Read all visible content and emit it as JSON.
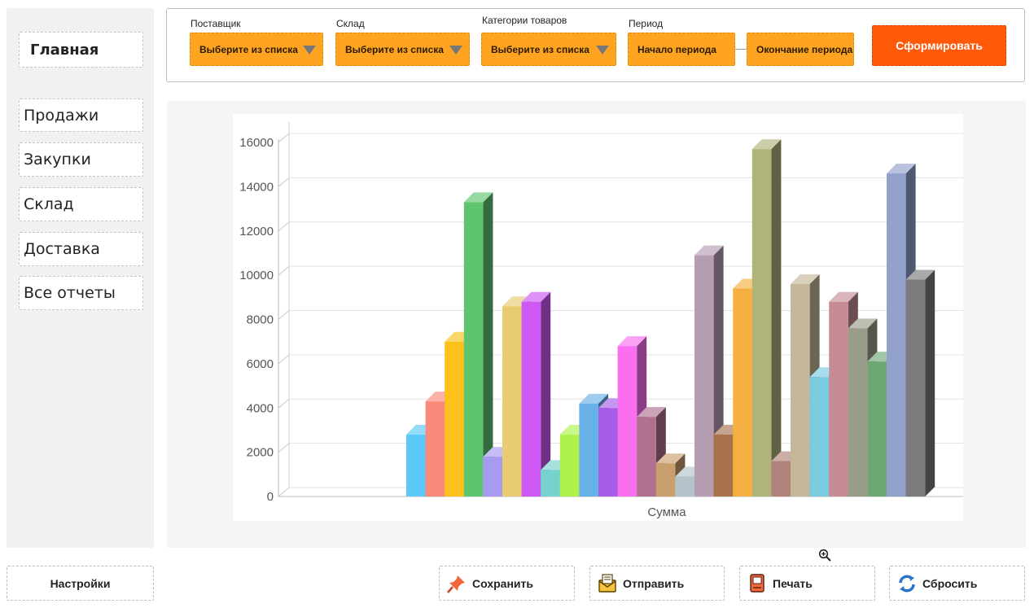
{
  "sidebar": {
    "home": "Главная",
    "items": [
      {
        "label": "Продажи"
      },
      {
        "label": "Закупки"
      },
      {
        "label": "Склад"
      },
      {
        "label": "Доставка"
      },
      {
        "label": "Все отчеты"
      }
    ],
    "settings": "Настройки"
  },
  "filters": {
    "supplier_label": "Поставщик",
    "supplier_value": "Выберите из списка",
    "warehouse_label": "Склад",
    "warehouse_value": "Выберите из списка",
    "category_label": "Категории товаров",
    "category_value": "Выберите из списка",
    "period_label": "Период",
    "period_start": "Начало периода",
    "period_end": "Окончание периода",
    "generate": "Сформировать"
  },
  "footer": {
    "save": "Сохранить",
    "send": "Отправить",
    "print": "Печать",
    "reset": "Сбросить"
  },
  "colors": {
    "dropdown": "#ffa421",
    "generate": "#ff5a0a"
  },
  "chart_data": {
    "type": "bar",
    "xlabel": "Сумма",
    "ylim": [
      0,
      16000
    ],
    "yticks": [
      0,
      2000,
      4000,
      6000,
      8000,
      10000,
      12000,
      14000,
      16000
    ],
    "grid": true,
    "legend": "none",
    "series": [
      {
        "value": 2800,
        "color": "#5bc8f7"
      },
      {
        "value": 4300,
        "color": "#f98a7a"
      },
      {
        "value": 7000,
        "color": "#fcc11a"
      },
      {
        "value": 13300,
        "color": "#5ec46e"
      },
      {
        "value": 1800,
        "color": "#a79af0"
      },
      {
        "value": 8600,
        "color": "#e9cb71"
      },
      {
        "value": 8800,
        "color": "#cc58f5"
      },
      {
        "value": 1200,
        "color": "#75d2cc"
      },
      {
        "value": 2800,
        "color": "#adf24a"
      },
      {
        "value": 4200,
        "color": "#68b0e8"
      },
      {
        "value": 4000,
        "color": "#a85de8"
      },
      {
        "value": 6800,
        "color": "#fa6ef0"
      },
      {
        "value": 3600,
        "color": "#b0718e"
      },
      {
        "value": 1500,
        "color": "#c99f6e"
      },
      {
        "value": 900,
        "color": "#b4c2ca"
      },
      {
        "value": 10900,
        "color": "#b59db2"
      },
      {
        "value": 2800,
        "color": "#a8724c"
      },
      {
        "value": 9400,
        "color": "#f6b042"
      },
      {
        "value": 15700,
        "color": "#b0b37a"
      },
      {
        "value": 1600,
        "color": "#b0827a"
      },
      {
        "value": 9600,
        "color": "#c4b79a"
      },
      {
        "value": 5400,
        "color": "#7acbe0"
      },
      {
        "value": 8800,
        "color": "#c68c96"
      },
      {
        "value": 7600,
        "color": "#9a9c8a"
      },
      {
        "value": 6100,
        "color": "#6da874"
      },
      {
        "value": 14600,
        "color": "#92a0cc"
      },
      {
        "value": 9800,
        "color": "#7b7b7d"
      }
    ]
  }
}
